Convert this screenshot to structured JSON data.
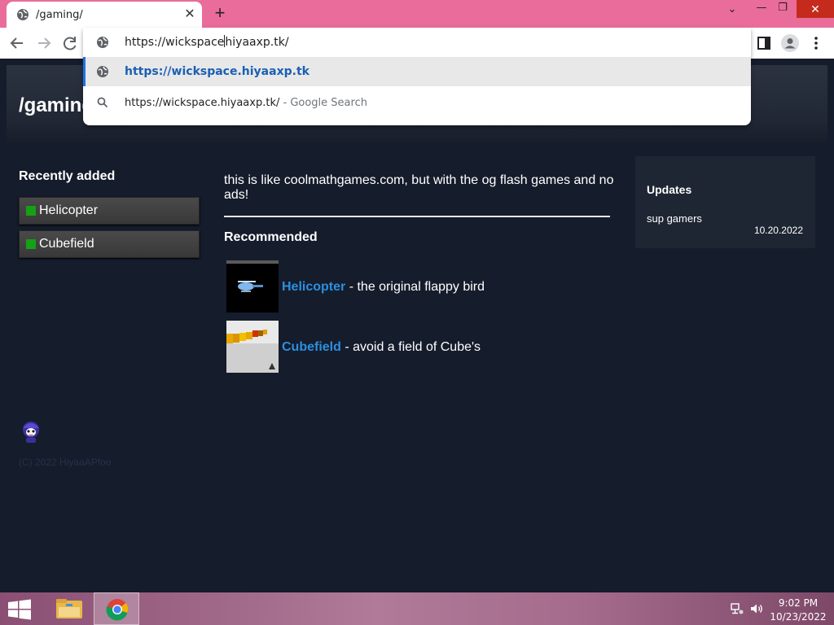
{
  "browser": {
    "tab_title": "/gaming/",
    "tab_close": "✕",
    "new_tab": "+",
    "url_before_caret": "https://wickspace",
    "url_after_caret": "hiyaaxp.tk/",
    "suggestions": [
      {
        "text": "https://wickspace.hiyaaxp.tk",
        "hint": "",
        "icon": "globe-icon"
      },
      {
        "text": "https://wickspace.hiyaaxp.tk/",
        "hint": " - Google Search",
        "icon": "search-icon"
      }
    ],
    "window_controls": {
      "dropdown": "⌄",
      "minimize": "—",
      "restore": "❐",
      "close": "✕"
    },
    "accent_color": "#1a73e8",
    "tabbar_color": "#e96c9a"
  },
  "page": {
    "title": "/gaming/",
    "sidebar": {
      "heading": "Recently added",
      "items": [
        {
          "label": "Helicopter"
        },
        {
          "label": "Cubefield"
        }
      ]
    },
    "intro": "this is like coolmathgames.com, but with the og flash games and no ads!",
    "recommended": {
      "heading": "Recommended",
      "games": [
        {
          "name": "Helicopter",
          "desc": " - the original flappy bird"
        },
        {
          "name": "Cubefield",
          "desc": " - avoid a field of Cube's"
        }
      ]
    },
    "updates": {
      "title": "Updates",
      "entries": [
        {
          "text": "sup gamers",
          "date": "10.20.2022"
        }
      ]
    },
    "footer": {
      "copyright": "(C) 2022 HiyaaAPfoo"
    },
    "link_color": "#2b8fe0",
    "background_color": "#151c2b"
  },
  "taskbar": {
    "apps": [
      "file-explorer-icon",
      "chrome-icon"
    ],
    "time": "9:02 PM",
    "date": "10/23/2022"
  }
}
